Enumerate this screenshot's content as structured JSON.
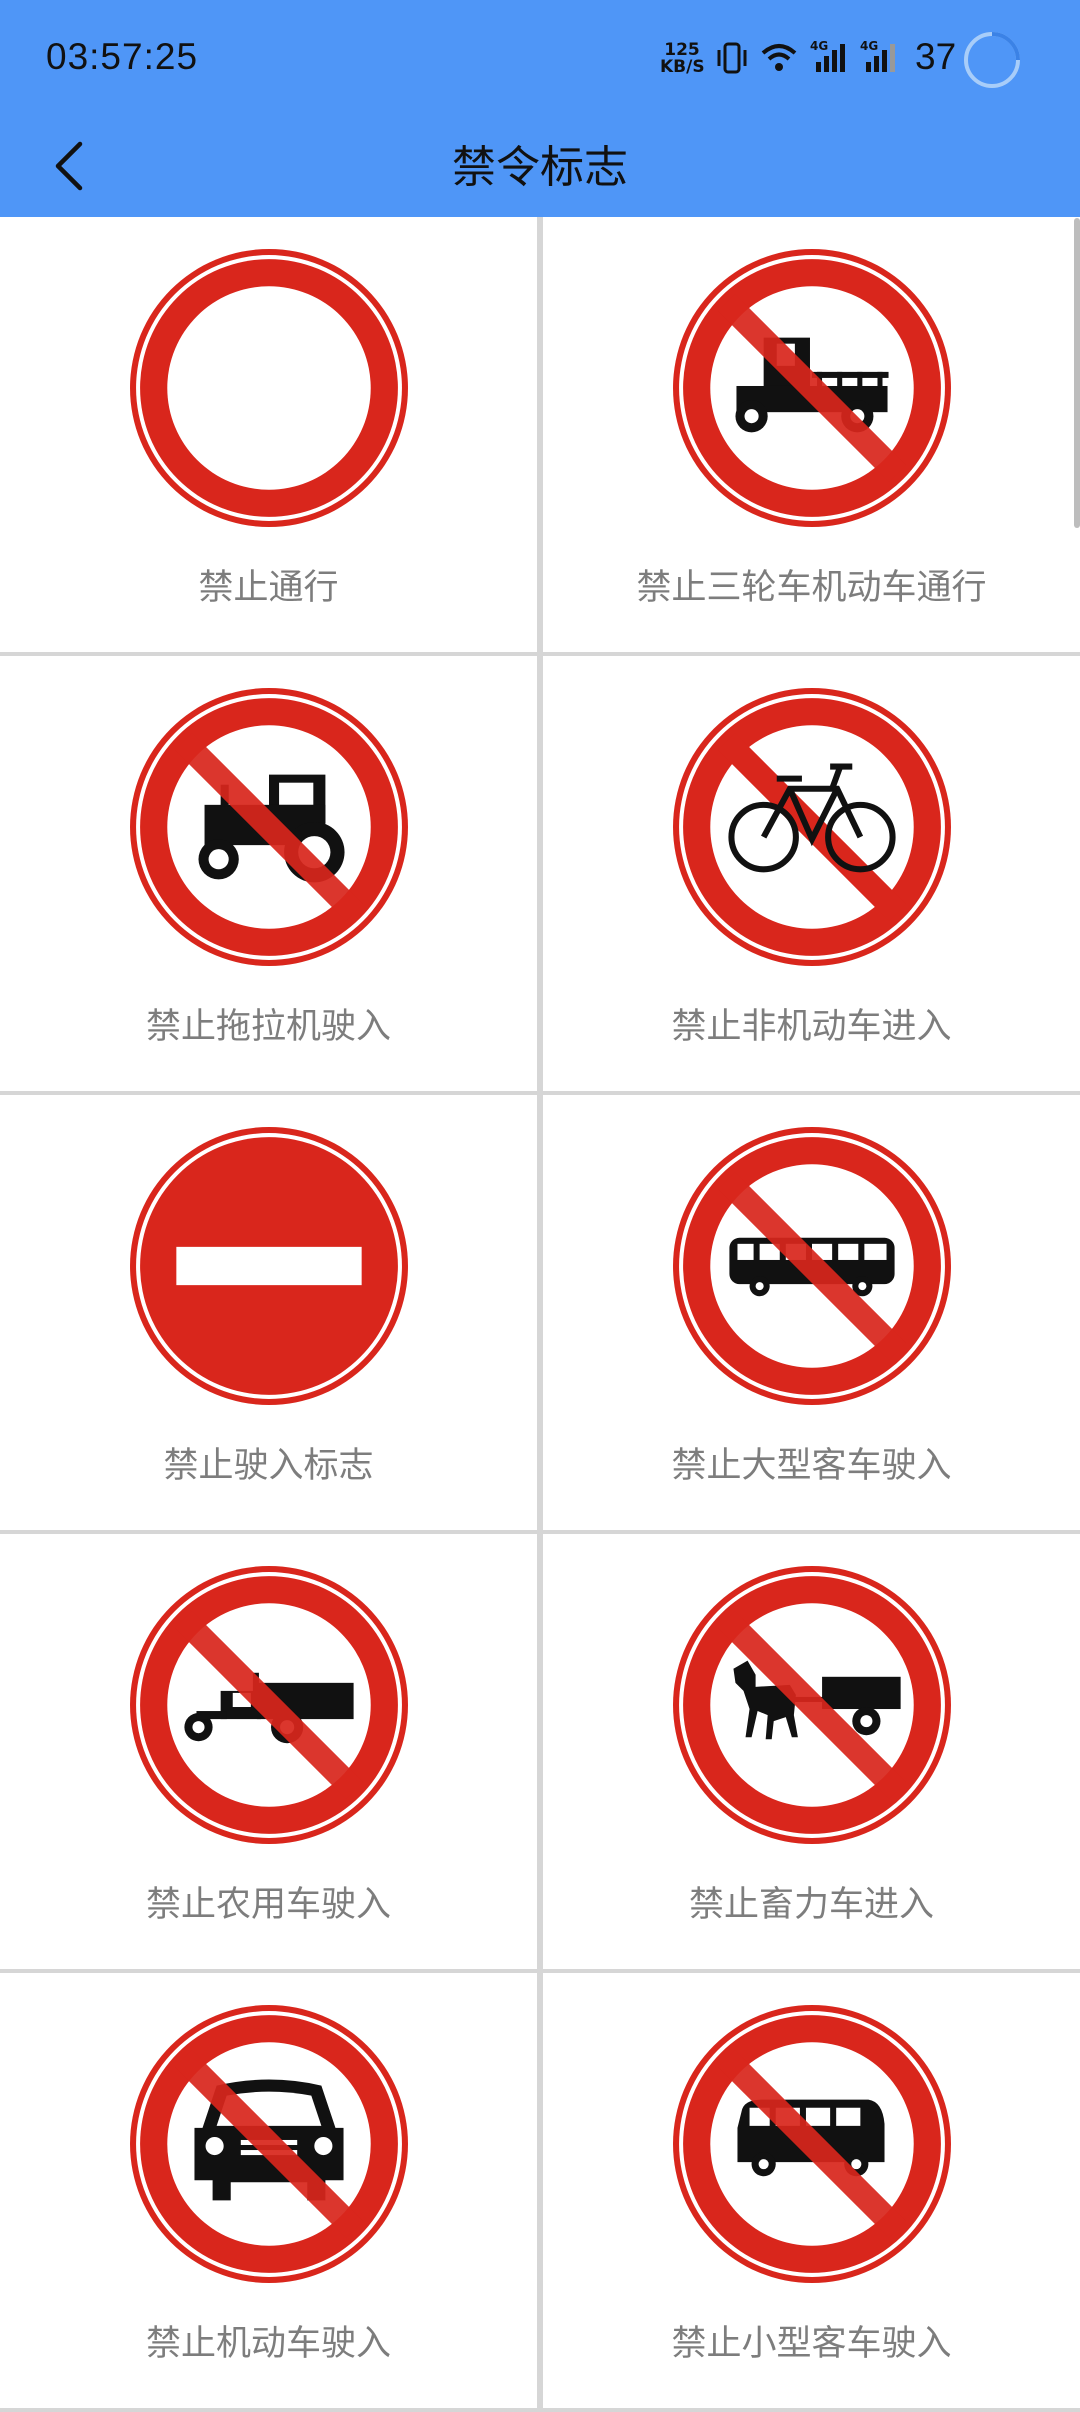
{
  "status": {
    "time": "03:57:25",
    "speed_value": "125",
    "speed_unit": "KB/S",
    "network1": "4G",
    "network2": "4G",
    "battery": "37"
  },
  "nav": {
    "title": "禁令标志",
    "back_icon": "chevron-left-icon"
  },
  "colors": {
    "header": "#4f96f7",
    "sign_red": "#d9261c",
    "label": "#7d7d7d"
  },
  "signs": [
    {
      "label": "禁止通行",
      "icon": "no-entry-ring-icon"
    },
    {
      "label": "禁止三轮车机动车通行",
      "icon": "no-tricycle-icon"
    },
    {
      "label": "禁止拖拉机驶入",
      "icon": "no-tractor-icon"
    },
    {
      "label": "禁止非机动车进入",
      "icon": "no-bicycle-icon"
    },
    {
      "label": "禁止驶入标志",
      "icon": "no-entry-bar-icon"
    },
    {
      "label": "禁止大型客车驶入",
      "icon": "no-bus-icon"
    },
    {
      "label": "禁止农用车驶入",
      "icon": "no-farm-vehicle-icon"
    },
    {
      "label": "禁止畜力车进入",
      "icon": "no-animal-cart-icon"
    },
    {
      "label": "禁止机动车驶入",
      "icon": "no-motor-vehicle-icon"
    },
    {
      "label": "禁止小型客车驶入",
      "icon": "no-minibus-icon"
    }
  ]
}
